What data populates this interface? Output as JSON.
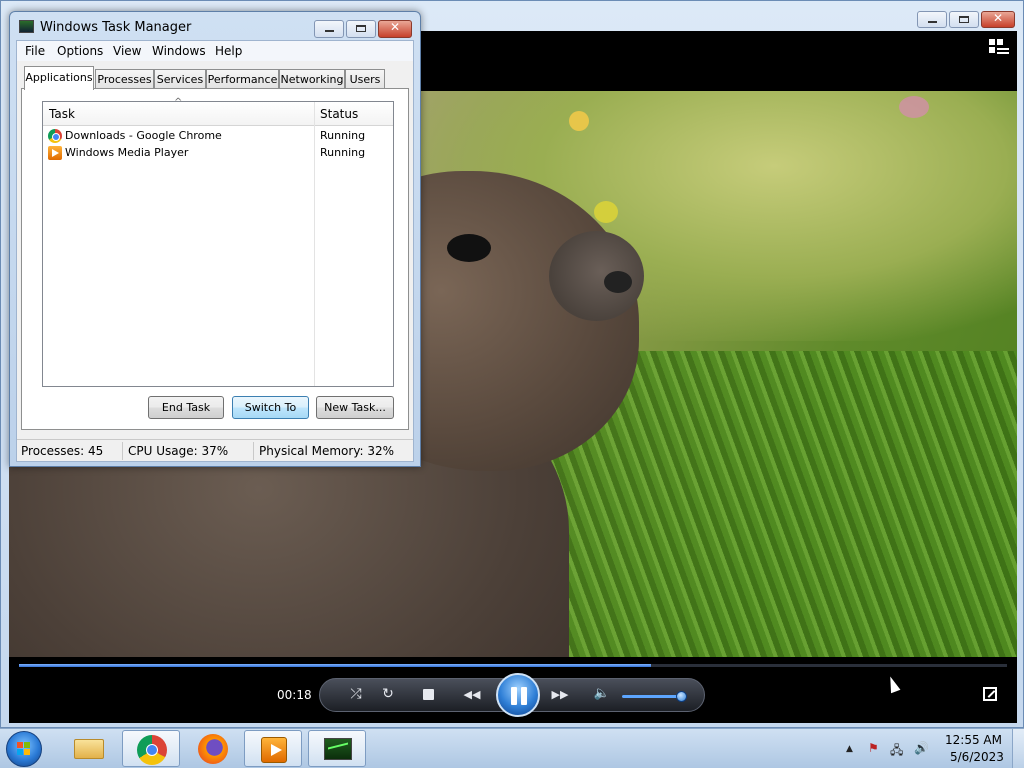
{
  "media_player": {
    "time_elapsed": "00:18",
    "progress_fraction": 0.64,
    "volume_fraction": 0.94,
    "controls": {
      "shuffle_icon": "⤮",
      "repeat_icon": "↻",
      "previous_icon": "◀◀",
      "next_icon": "▶▶",
      "mute_icon": "🔈"
    },
    "caption": {
      "minimize_icon": "minimize-icon",
      "maximize_icon": "maximize-icon",
      "close_glyph": "✕"
    }
  },
  "task_manager": {
    "title": "Windows Task Manager",
    "close_glyph": "✕",
    "menu": [
      "File",
      "Options",
      "View",
      "Windows",
      "Help"
    ],
    "tabs": [
      "Applications",
      "Processes",
      "Services",
      "Performance",
      "Networking",
      "Users"
    ],
    "active_tab": "Applications",
    "columns": {
      "task": "Task",
      "status": "Status"
    },
    "sort_glyph": "^",
    "rows": [
      {
        "task": "Downloads - Google Chrome",
        "status": "Running",
        "icon": "chrome-icon"
      },
      {
        "task": "Windows Media Player",
        "status": "Running",
        "icon": "windows-media-player-icon"
      }
    ],
    "buttons": {
      "end_task": "End Task",
      "switch_to": "Switch To",
      "new_task": "New Task..."
    },
    "status": {
      "processes": "Processes: 45",
      "cpu": "CPU Usage: 37%",
      "memory": "Physical Memory: 32%"
    }
  },
  "taskbar": {
    "apps": [
      "windows-explorer",
      "google-chrome",
      "firefox",
      "windows-media-player",
      "task-manager"
    ],
    "tray": {
      "expand_glyph": "▲",
      "flag_glyph": "⚑",
      "network_glyph": "🖧",
      "volume_glyph": "🔊"
    },
    "clock_time": "12:55 AM",
    "clock_date": "5/6/2023"
  },
  "colors": {
    "accent": "#2f7fd6",
    "taskbar": "#bcd1ea",
    "window_frame": "#cfe0f3"
  }
}
